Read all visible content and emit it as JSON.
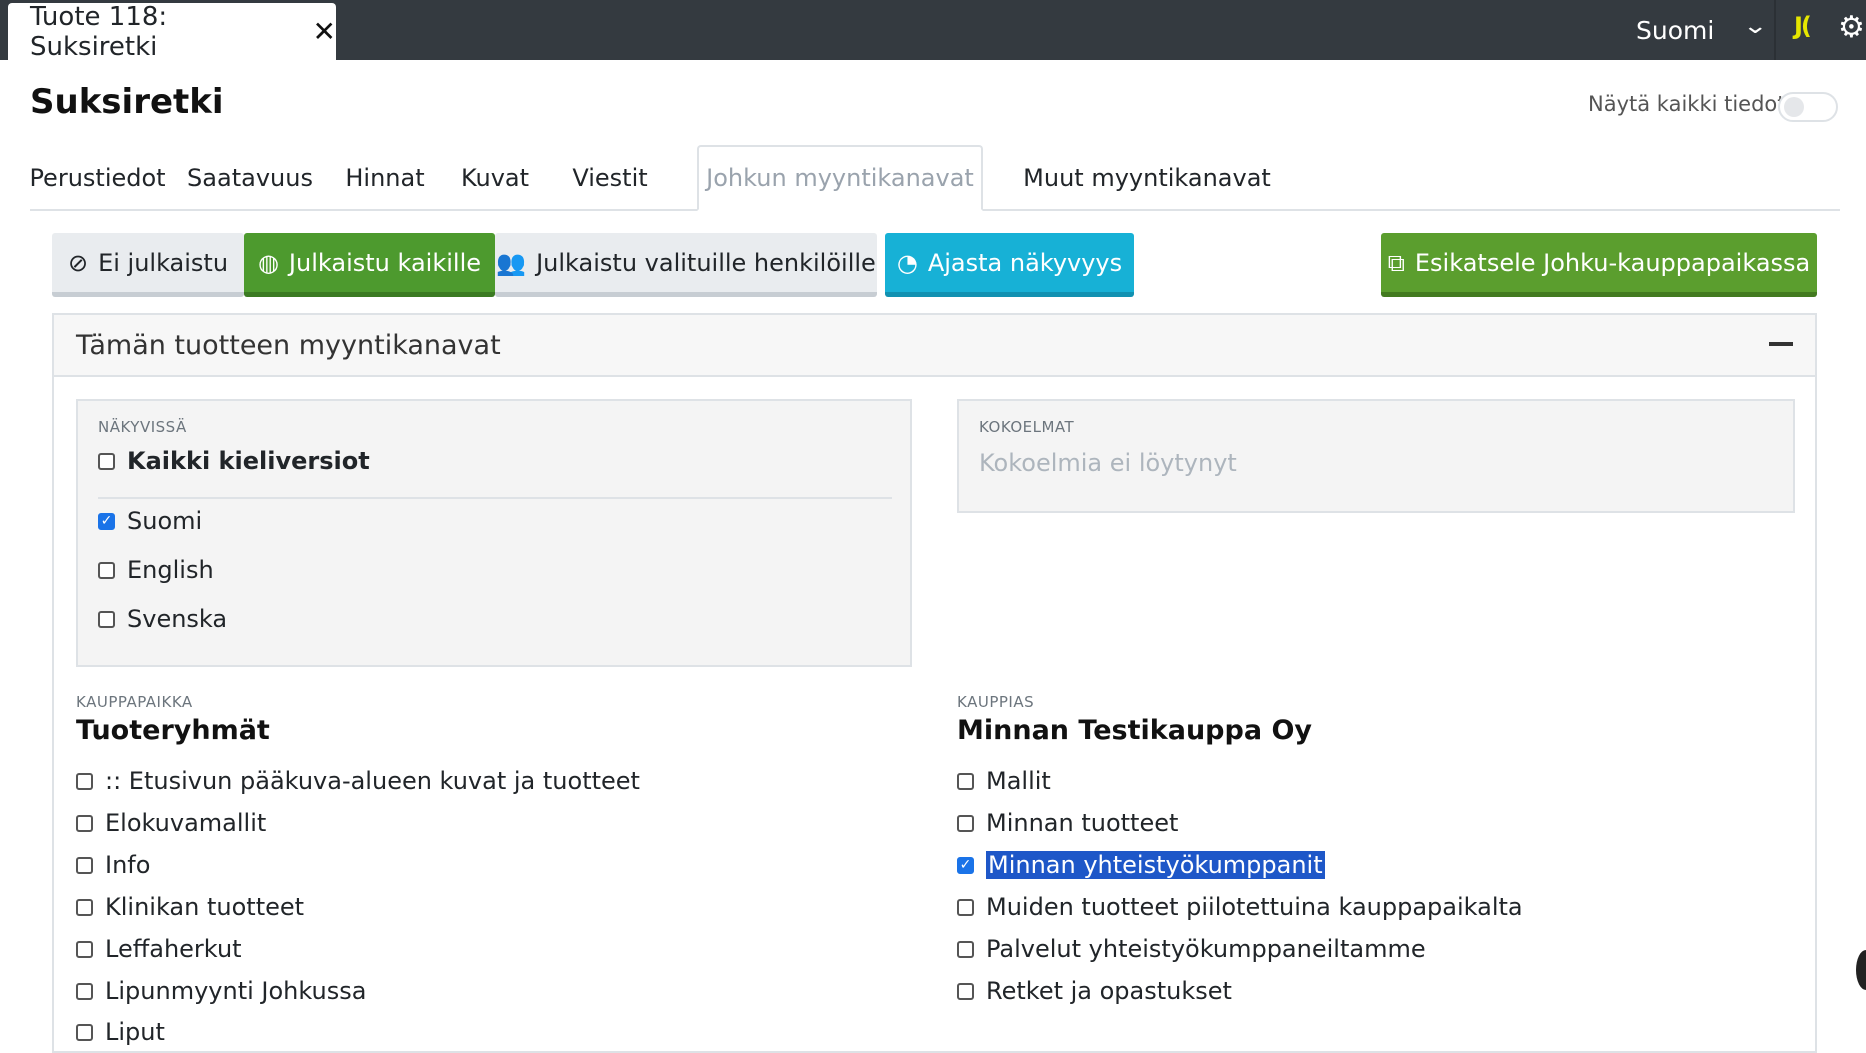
{
  "topbar": {
    "doc_tab_title": "Tuote 118: Suksiretki",
    "close_symbol": "✕",
    "language": "Suomi",
    "brand": "J(",
    "icons": {
      "chevron": "chevron-down-icon",
      "gear": "gear-icon"
    }
  },
  "header": {
    "title": "Suksiretki",
    "show_all_label": "Näytä kaikki tiedot",
    "show_all_on": false
  },
  "tabs": [
    {
      "label": "Perustiedot",
      "active": false
    },
    {
      "label": "Saatavuus",
      "active": false
    },
    {
      "label": "Hinnat",
      "active": false
    },
    {
      "label": "Kuvat",
      "active": false
    },
    {
      "label": "Viestit",
      "active": false
    },
    {
      "label": "Johkun myyntikanavat",
      "active": true
    },
    {
      "label": "Muut myyntikanavat",
      "active": false
    }
  ],
  "publish": {
    "not_published": "Ei julkaistu",
    "published_all": "Julkaistu kaikille",
    "published_selected": "Julkaistu valituille henkilöille",
    "schedule": "Ajasta näkyvyys",
    "preview": "Esikatsele Johku-kauppapaikassa",
    "active": "published_all"
  },
  "channels": {
    "title": "Tämän tuotteen myyntikanavat",
    "visible": {
      "label": "NÄKYVISSÄ",
      "all_languages": {
        "label": "Kaikki kieliversiot",
        "checked": false
      },
      "languages": [
        {
          "label": "Suomi",
          "checked": true
        },
        {
          "label": "English",
          "checked": false
        },
        {
          "label": "Svenska",
          "checked": false
        }
      ]
    },
    "collections": {
      "label": "KOKOELMAT",
      "empty_text": "Kokoelmia ei löytynyt"
    },
    "marketplace": {
      "label": "KAUPPAPAIKKA",
      "title": "Tuoteryhmät",
      "items": [
        {
          "label": ":: Etusivun pääkuva-alueen kuvat ja tuotteet",
          "checked": false
        },
        {
          "label": "Elokuvamallit",
          "checked": false
        },
        {
          "label": "Info",
          "checked": false
        },
        {
          "label": "Klinikan tuotteet",
          "checked": false
        },
        {
          "label": "Leffaherkut",
          "checked": false
        },
        {
          "label": "Lipunmyynti Johkussa",
          "checked": false
        },
        {
          "label": "Liput",
          "checked": false
        }
      ]
    },
    "merchant": {
      "label": "KAUPPIAS",
      "title": "Minnan Testikauppa Oy",
      "items": [
        {
          "label": "Mallit",
          "checked": false
        },
        {
          "label": "Minnan tuotteet",
          "checked": false
        },
        {
          "label": "Minnan yhteistyökumppanit",
          "checked": true,
          "selected": true
        },
        {
          "label": "Muiden tuotteet piilotettuina kauppapaikalta",
          "checked": false
        },
        {
          "label": "Palvelut yhteistyökumppaneiltamme",
          "checked": false
        },
        {
          "label": "Retket ja opastukset",
          "checked": false
        }
      ]
    }
  }
}
